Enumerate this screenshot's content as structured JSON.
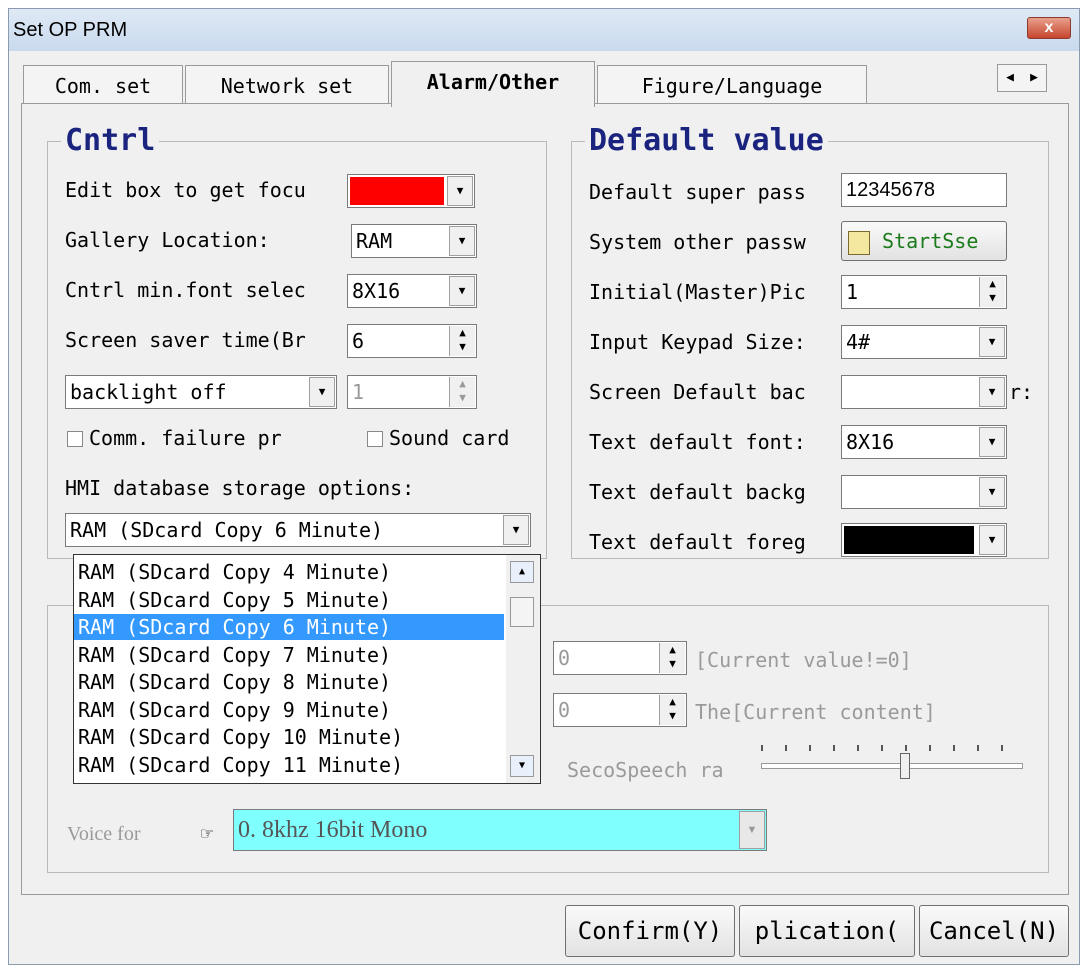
{
  "window": {
    "title": "Set OP PRM",
    "close": "x"
  },
  "tabs": [
    "Com. set",
    "Network set",
    "Alarm/Other",
    "Figure/Language"
  ],
  "tab_scroll": {
    "left": "◀",
    "right": "▶"
  },
  "cntrl": {
    "title": "Cntrl",
    "edit_focus_label": "Edit box to get focu",
    "edit_focus_color": "#ff0000",
    "gallery_label": "Gallery Location:",
    "gallery_value": "RAM",
    "minfont_label": "Cntrl min.font selec",
    "minfont_value": "8X16",
    "saver_label": "Screen saver time(Br",
    "saver_value": "6",
    "backlight_value": "backlight off",
    "backlight_num": "1",
    "comm_failure_label": "Comm. failure pr",
    "sound_card_label": "Sound card",
    "hmi_db_label": "HMI database storage options:",
    "hmi_db_value": "RAM (SDcard Copy 6 Minute)"
  },
  "dropdown_options": [
    "RAM (SDcard Copy 4 Minute)",
    "RAM (SDcard Copy 5 Minute)",
    "RAM (SDcard Copy 6 Minute)",
    "RAM (SDcard Copy 7 Minute)",
    "RAM (SDcard Copy 8 Minute)",
    "RAM (SDcard Copy 9 Minute)",
    "RAM (SDcard Copy 10 Minute)",
    "RAM (SDcard Copy 11 Minute)"
  ],
  "dropdown_selected_index": 2,
  "default_value": {
    "title": "Default value",
    "super_pass_label": "Default super pass",
    "super_pass_value": "12345678",
    "sys_other_label": "System other passw",
    "startsse_label": "StartSse",
    "initial_label": "Initial(Master)Pic",
    "initial_value": "1",
    "keypad_label": "Input Keypad Size:",
    "keypad_value": "4#",
    "screen_bg_label": "Screen Default bac",
    "screen_bg_suffix": "r:",
    "text_font_label": "Text default font:",
    "text_font_value": "8X16",
    "text_bg_label": "Text default backg",
    "text_fg_label": "Text default foreg",
    "text_fg_color": "#000000"
  },
  "lower": {
    "spin1_value": "0",
    "current_value_label": "[Current value!=0]",
    "spin2_value": "0",
    "current_content_label": "The[Current content]",
    "speech_label": "SecoSpeech ra",
    "slider_level": 0.55,
    "voice_format_label": "Voice for",
    "voice_format_value": "0. 8khz  16bit Mono"
  },
  "buttons": {
    "confirm": "Confirm(Y)",
    "apply": "plication(",
    "cancel": "Cancel(N)"
  }
}
